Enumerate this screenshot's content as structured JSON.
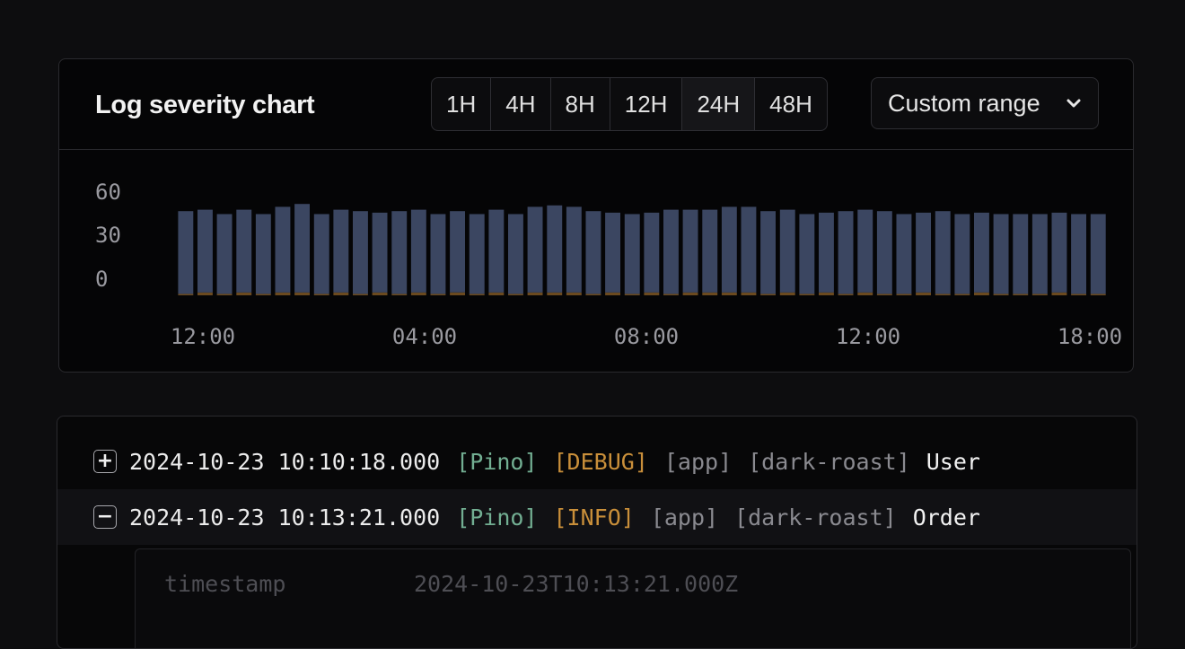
{
  "header": {
    "title": "Log severity chart",
    "ranges": [
      "1H",
      "4H",
      "8H",
      "12H",
      "24H",
      "48H"
    ],
    "active_range": "24H",
    "custom_range_label": "Custom range"
  },
  "chart_data": {
    "type": "bar",
    "stacked": true,
    "yticks": [
      "60",
      "30",
      "0"
    ],
    "xticks": [
      "12:00",
      "04:00",
      "08:00",
      "12:00",
      "18:00"
    ],
    "ylim": [
      0,
      60
    ],
    "series": [
      {
        "color": "#3b4661",
        "values": [
          57,
          57,
          55,
          57,
          55,
          59,
          61,
          55,
          57,
          57,
          55,
          57,
          57,
          55,
          56,
          55,
          57,
          55,
          59,
          60,
          59,
          57,
          55,
          55,
          55,
          58,
          57,
          57,
          59,
          59,
          57,
          57,
          55,
          55,
          57,
          57,
          57,
          55,
          55,
          57,
          55,
          55,
          55,
          55,
          55,
          55,
          55,
          55
        ]
      },
      {
        "color": "#6b4a1f",
        "values": [
          1,
          2,
          1,
          2,
          1,
          2,
          2,
          1,
          2,
          1,
          2,
          1,
          2,
          1,
          2,
          1,
          2,
          1,
          2,
          2,
          2,
          1,
          2,
          1,
          2,
          1,
          2,
          2,
          2,
          2,
          1,
          2,
          1,
          2,
          1,
          2,
          1,
          1,
          2,
          1,
          1,
          2,
          1,
          1,
          1,
          2,
          1,
          1
        ]
      }
    ]
  },
  "logs": [
    {
      "toggle": "+",
      "timestamp": "2024-10-23 10:10:18.000",
      "source": "[Pino]",
      "level": "[DEBUG]",
      "tag1": "[app]",
      "tag2": "[dark-roast]",
      "message": "User"
    },
    {
      "toggle": "−",
      "timestamp": "2024-10-23 10:13:21.000",
      "source": "[Pino]",
      "level": "[INFO]",
      "tag1": "[app]",
      "tag2": "[dark-roast]",
      "message": "Order"
    }
  ],
  "detail": {
    "key": "timestamp",
    "value": "2024-10-23T10:13:21.000Z"
  },
  "colors": {
    "bar": "#3b4661",
    "bar_secondary": "#6b4a1f",
    "source": "#72ae92",
    "level": "#c98f3a"
  }
}
